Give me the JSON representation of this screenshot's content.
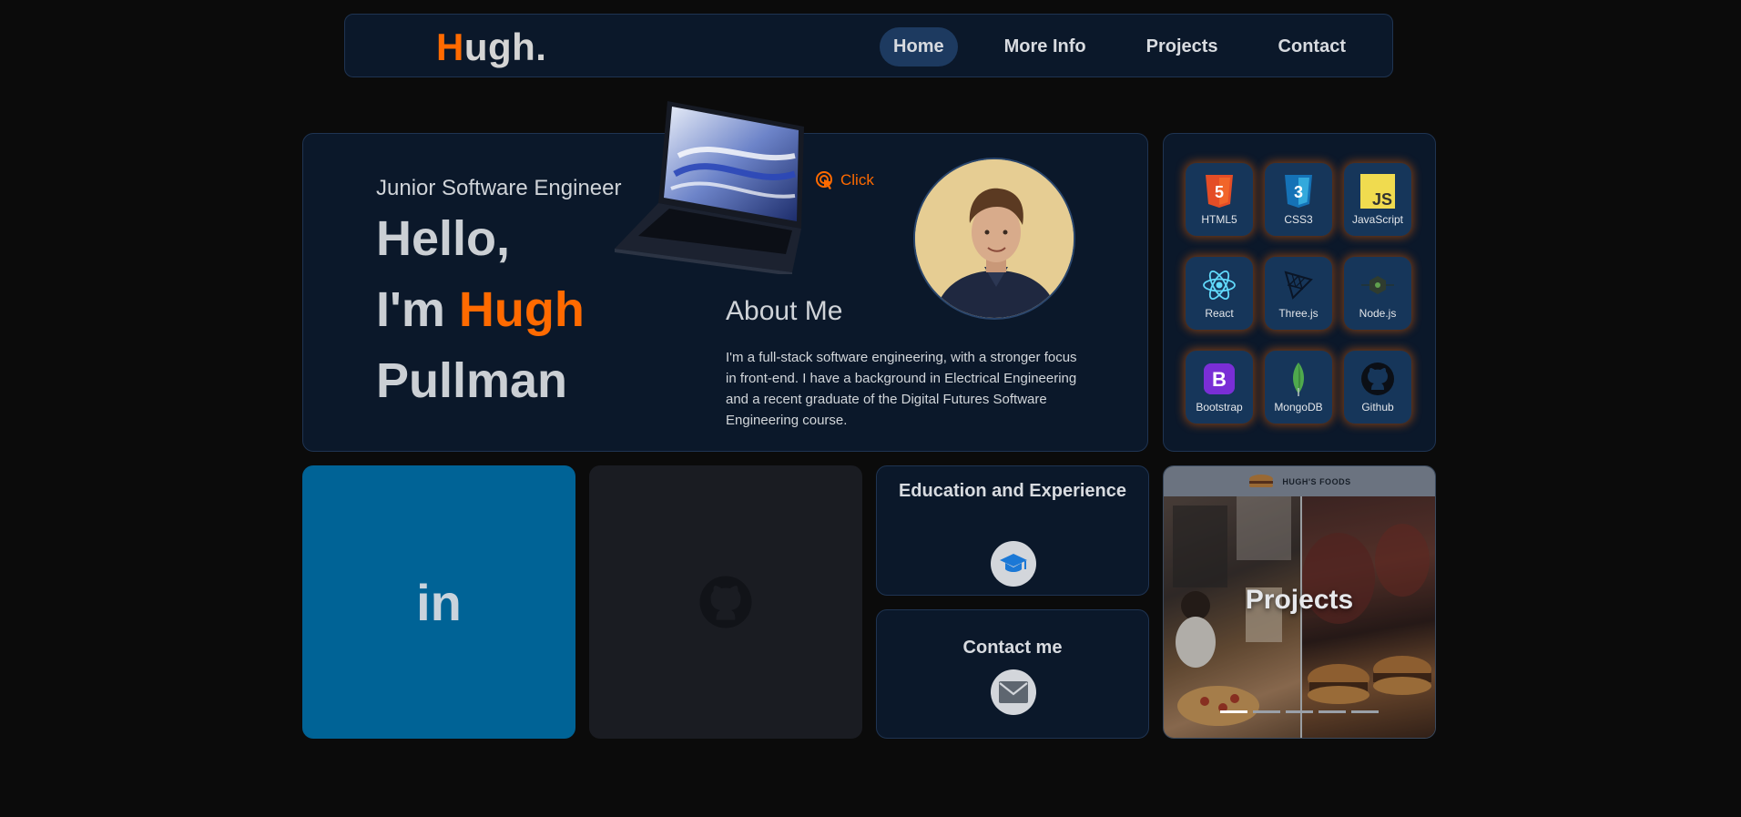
{
  "nav": {
    "logo_initial": "H",
    "logo_rest": "ugh.",
    "links": [
      {
        "label": "Home",
        "active": true
      },
      {
        "label": "More Info",
        "active": false
      },
      {
        "label": "Projects",
        "active": false
      },
      {
        "label": "Contact",
        "active": false
      }
    ]
  },
  "hero": {
    "subtitle": "Junior Software Engineer",
    "hello": "Hello,",
    "im": "I'm ",
    "first_name": "Hugh",
    "last_name": "Pullman",
    "click_label": "Click",
    "about_title": "About Me",
    "about_text": "I'm a full-stack software engineering, with a stronger focus in front-end. I have a background in Electrical Engineering and a recent graduate of the Digital Futures Software Engineering course."
  },
  "skills": [
    {
      "label": "HTML5",
      "icon": "html5-icon"
    },
    {
      "label": "CSS3",
      "icon": "css3-icon"
    },
    {
      "label": "JavaScript",
      "icon": "javascript-icon"
    },
    {
      "label": "React",
      "icon": "react-icon"
    },
    {
      "label": "Three.js",
      "icon": "threejs-icon"
    },
    {
      "label": "Node.js",
      "icon": "nodejs-icon"
    },
    {
      "label": "Bootstrap",
      "icon": "bootstrap-icon"
    },
    {
      "label": "MongoDB",
      "icon": "mongodb-icon"
    },
    {
      "label": "Github",
      "icon": "github-icon"
    }
  ],
  "tiles": {
    "linkedin": "in",
    "education_title": "Education and Experience",
    "contact_title": "Contact me",
    "projects_header": "HUGH'S FOODS",
    "projects_title": "Projects",
    "projects_slides": 5,
    "projects_active_slide": 1
  },
  "colors": {
    "accent": "#ff6a00",
    "card_bg": "#0b182a",
    "page_bg": "#0b0b0b",
    "linkedin_bg": "#006396"
  }
}
